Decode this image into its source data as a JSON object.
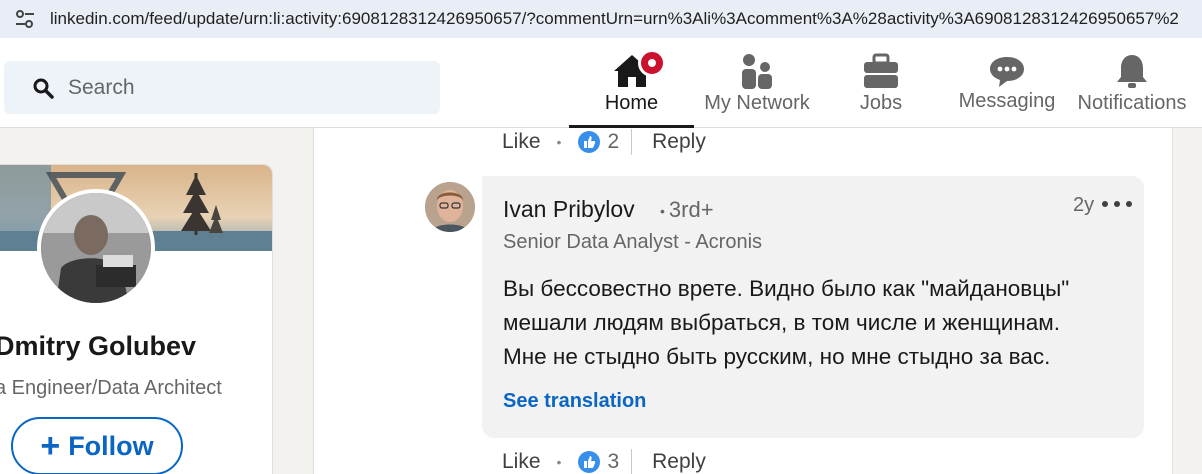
{
  "browser": {
    "url": "linkedin.com/feed/update/urn:li:activity:6908128312426950657/?commentUrn=urn%3Ali%3Acomment%3A%28activity%3A6908128312426950657%2"
  },
  "header": {
    "search_placeholder": "Search",
    "nav": [
      {
        "label": "Home",
        "icon": "home-icon",
        "active": true
      },
      {
        "label": "My Network",
        "icon": "network-icon"
      },
      {
        "label": "Jobs",
        "icon": "briefcase-icon"
      },
      {
        "label": "Messaging",
        "icon": "chat-icon"
      },
      {
        "label": "Notifications",
        "icon": "bell-icon"
      }
    ]
  },
  "profile": {
    "name": "Dmitry Golubev",
    "title": "a Engineer/Data Architect",
    "follow_label": "Follow"
  },
  "prev_actions": {
    "like": "Like",
    "count": "2",
    "reply": "Reply"
  },
  "comment": {
    "author": "Ivan Pribylov",
    "degree": "3rd+",
    "time": "2y",
    "subtitle": "Senior Data Analyst - Acronis",
    "text_lines": [
      "Вы бессовестно врете. Видно было как \"майдановцы\"",
      "мешали людям выбраться, в том числе и женщинам.",
      "Мне не стыдно быть русским, но мне стыдно за вас."
    ],
    "see_translation": "See translation",
    "actions": {
      "like": "Like",
      "count": "3",
      "reply": "Reply"
    }
  },
  "colors": {
    "accent": "#0a66c2",
    "badge": "#cb112d",
    "background": "#f4f2ee"
  }
}
